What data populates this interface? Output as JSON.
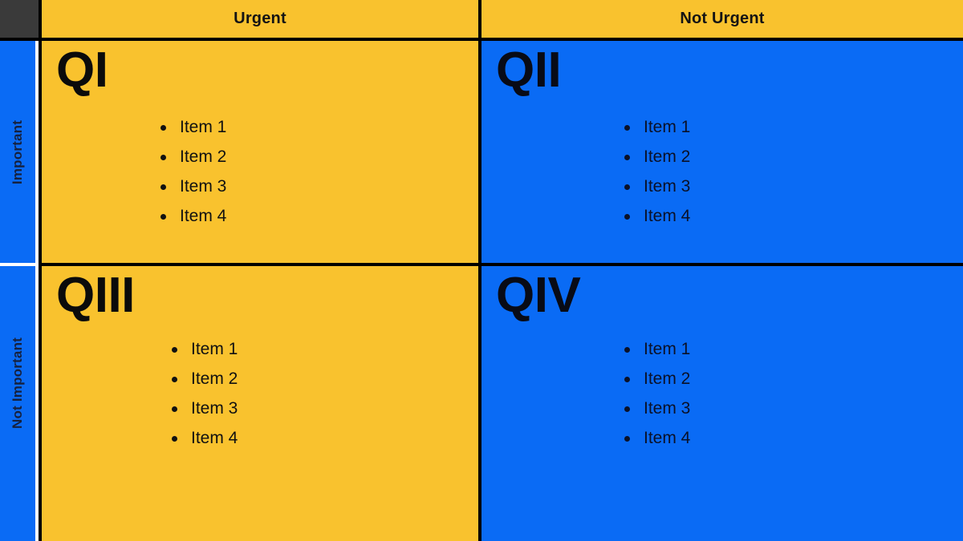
{
  "corner": {
    "label": ""
  },
  "columns": [
    {
      "id": "urgent",
      "label": "Urgent"
    },
    {
      "id": "not-urgent",
      "label": "Not Urgent"
    }
  ],
  "rows": [
    {
      "id": "important",
      "label": "Important"
    },
    {
      "id": "not-important",
      "label": "Not Important"
    }
  ],
  "quadrants": [
    {
      "id": "q1",
      "title": "QI",
      "row": "Important",
      "column": "Urgent",
      "background": "#f9c22e",
      "items": [
        "Item 1",
        "Item 2",
        "Item 3",
        "Item 4"
      ]
    },
    {
      "id": "q2",
      "title": "QII",
      "row": "Important",
      "column": "Not Urgent",
      "background": "#0a6bf5",
      "items": [
        "Item 1",
        "Item 2",
        "Item 3",
        "Item 4"
      ]
    },
    {
      "id": "q3",
      "title": "QIII",
      "row": "Not Important",
      "column": "Urgent",
      "background": "#f9c22e",
      "items": [
        "Item 1",
        "Item 2",
        "Item 3",
        "Item 4"
      ]
    },
    {
      "id": "q4",
      "title": "QIV",
      "row": "Not Important",
      "column": "Not Urgent",
      "background": "#0a6bf5",
      "items": [
        "Item 1",
        "Item 2",
        "Item 3",
        "Item 4"
      ]
    }
  ],
  "colors": {
    "yellow": "#f9c22e",
    "blue": "#0a6bf5",
    "corner_dark": "#3a3a3a",
    "gridline": "#000000",
    "text_dark": "#111111",
    "text_navy": "#0a1128"
  }
}
